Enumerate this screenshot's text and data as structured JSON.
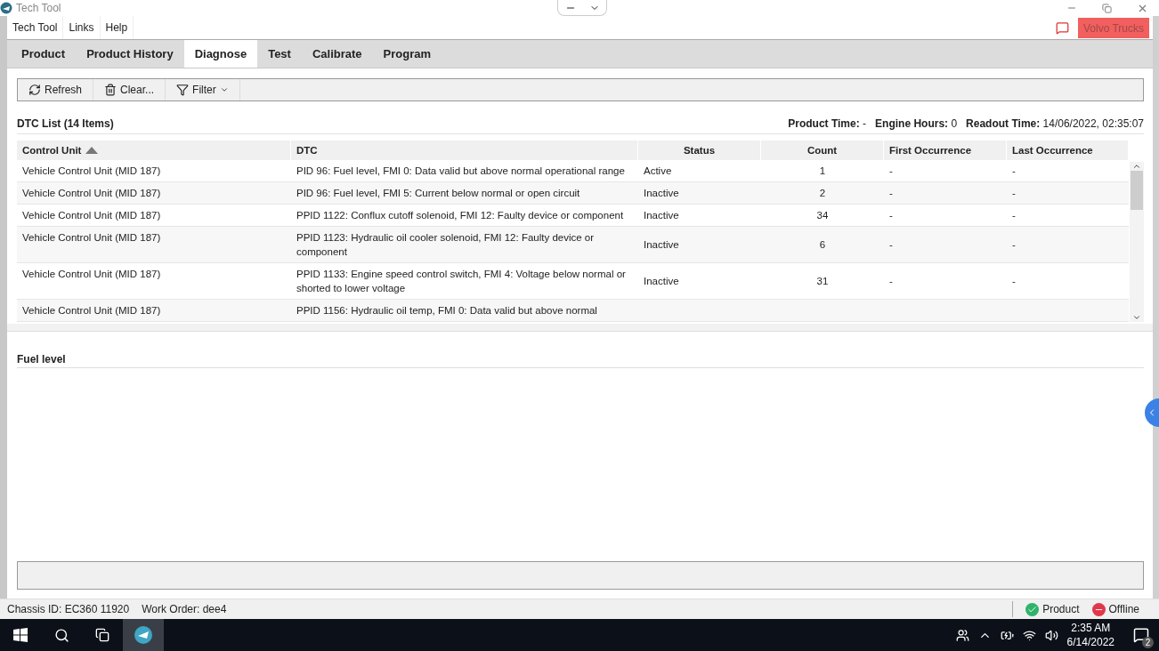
{
  "window": {
    "title": "Tech Tool"
  },
  "menu": [
    {
      "label": "Tech Tool"
    },
    {
      "label": "Links"
    },
    {
      "label": "Help"
    }
  ],
  "brand_button": {
    "label": "Volvo Trucks"
  },
  "tabs": [
    {
      "label": "Product",
      "selected": false
    },
    {
      "label": "Product History",
      "selected": false
    },
    {
      "label": "Diagnose",
      "selected": true
    },
    {
      "label": "Test",
      "selected": false
    },
    {
      "label": "Calibrate",
      "selected": false
    },
    {
      "label": "Program",
      "selected": false
    }
  ],
  "toolbar": [
    {
      "kind": "refresh",
      "label": "Refresh"
    },
    {
      "kind": "clear",
      "label": "Clear..."
    },
    {
      "kind": "filter",
      "label": "Filter"
    }
  ],
  "dtc_list": {
    "title": "DTC List (14 Items)",
    "info": [
      "**Product Time:** -",
      "**Engine Hours:** 0",
      "**Readout Time:** 14/06/2022, 02:35:07"
    ],
    "columns": [
      {
        "label": "Control Unit",
        "sorted": true,
        "kind": "text"
      },
      {
        "label": "DTC",
        "sorted": false,
        "kind": "text"
      },
      {
        "label": "Status",
        "sorted": false,
        "kind": "state"
      },
      {
        "label": "Count",
        "sorted": false,
        "kind": "number"
      },
      {
        "label": "First Occurrence",
        "sorted": false,
        "kind": "text"
      },
      {
        "label": "Last Occurrence",
        "sorted": false,
        "kind": "text"
      }
    ],
    "rows": [
      [
        "Vehicle Control Unit (MID 187)",
        "PID 96: Fuel level, FMI 0: Data valid but above normal operational range",
        "Active",
        "1",
        "-",
        "-"
      ],
      [
        "Vehicle Control Unit (MID 187)",
        "PID 96: Fuel level, FMI 5: Current below normal or open circuit",
        "Inactive",
        "2",
        "-",
        "-"
      ],
      [
        "Vehicle Control Unit (MID 187)",
        "PPID 1122: Conflux cutoff solenoid, FMI 12: Faulty device or component",
        "Inactive",
        "34",
        "-",
        "-"
      ],
      [
        "Vehicle Control Unit (MID 187)",
        "PPID 1123: Hydraulic oil cooler solenoid, FMI 12: Faulty device or component",
        "Inactive",
        "6",
        "-",
        "-"
      ],
      [
        "Vehicle Control Unit (MID 187)",
        "PPID 1133: Engine speed control switch, FMI 4: Voltage below normal or shorted to lower voltage",
        "Inactive",
        "31",
        "-",
        "-"
      ],
      [
        "Vehicle Control Unit (MID 187)",
        "PPID 1156: Hydraulic oil temp, FMI 0: Data valid but above normal"
      ]
    ]
  },
  "detail": {
    "title": "Fuel level"
  },
  "status_bar": {
    "items": [
      "Chassis ID: EC360 11920",
      "Work Order: dee4"
    ],
    "indicators": [
      {
        "label": "Product",
        "color": "#2fb36b",
        "kind": "ok"
      },
      {
        "label": "Offline",
        "color": "#e0384b",
        "kind": "off"
      }
    ]
  },
  "taskbar": {
    "time": "2:35 AM",
    "date": "6/14/2022",
    "notifications": "2"
  }
}
